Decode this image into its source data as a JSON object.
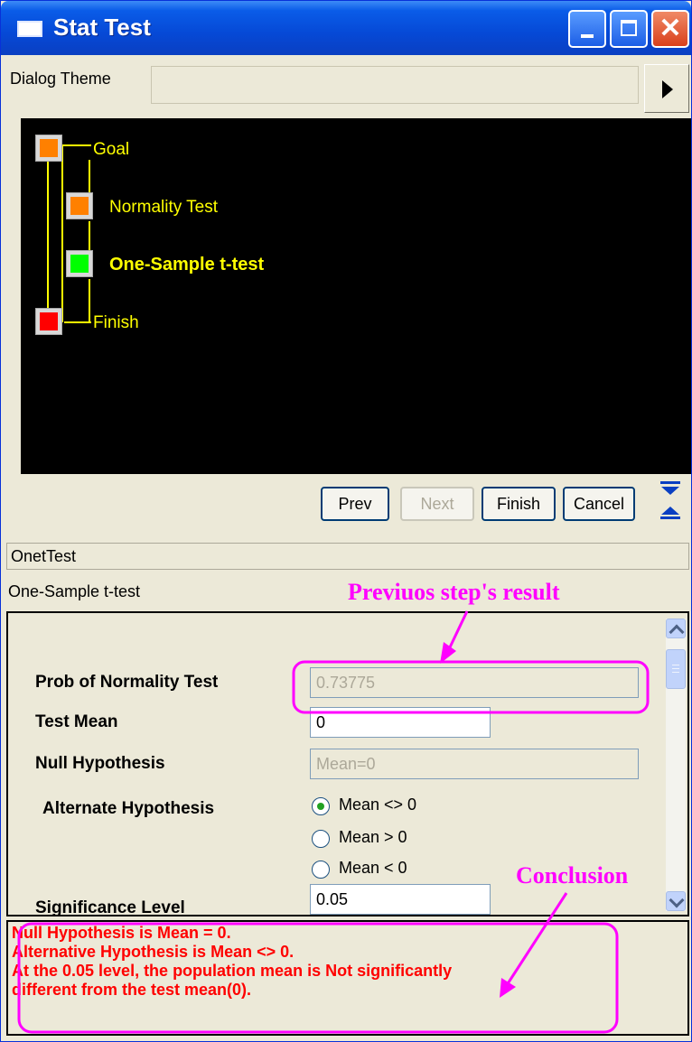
{
  "window": {
    "title": "Stat Test",
    "controls": [
      "minimize-icon",
      "maximize-icon",
      "close-icon"
    ]
  },
  "theme": {
    "label": "Dialog Theme",
    "value": ""
  },
  "flow": {
    "nodes": [
      {
        "label": "Goal",
        "color": "#ff8000",
        "state": "done"
      },
      {
        "label": "Normality Test",
        "color": "#ff8000",
        "state": "done"
      },
      {
        "label": "One-Sample t-test",
        "color": "#00ff00",
        "state": "current"
      },
      {
        "label": "Finish",
        "color": "#ff0000",
        "state": "pending"
      }
    ],
    "line_color": "#ffff00"
  },
  "nav": {
    "prev": "Prev",
    "next": "Next",
    "finish": "Finish",
    "cancel": "Cancel"
  },
  "dialog": {
    "name": "OnetTest",
    "subtitle": "One-Sample t-test"
  },
  "form": {
    "prob_normality": {
      "label": "Prob of Normality Test",
      "value": "0.73775"
    },
    "test_mean": {
      "label": "Test Mean",
      "value": "0"
    },
    "null_hypothesis": {
      "label": "Null Hypothesis",
      "value": "Mean=0"
    },
    "alternate": {
      "label": "Alternate Hypothesis",
      "options": [
        "Mean <> 0",
        "Mean > 0",
        "Mean < 0"
      ],
      "selected": "Mean <> 0"
    },
    "significance": {
      "label": "Significance Level",
      "value": "0.05"
    }
  },
  "result": {
    "lines": [
      "Null Hypothesis is Mean = 0.",
      "Alternative Hypothesis is Mean <> 0.",
      "At the 0.05 level, the population mean is Not significantly",
      "different from the test mean(0)."
    ]
  },
  "annotations": {
    "previous": "Previuos step's result",
    "conclusion": "Conclusion",
    "color": "#ff00ff"
  }
}
